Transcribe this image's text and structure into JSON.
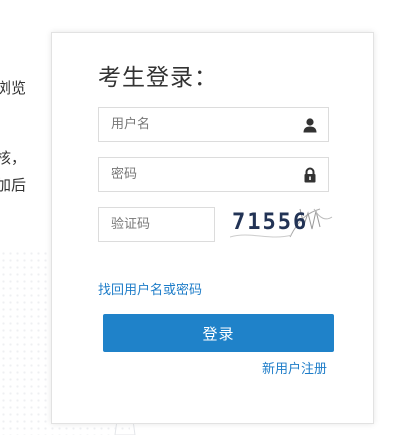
{
  "side_text": {
    "line1": "浏览",
    "line2": "核，",
    "line3": "加后"
  },
  "login": {
    "title": "考生登录：",
    "username": {
      "placeholder": "用户名",
      "value": "",
      "icon": "user-icon"
    },
    "password": {
      "placeholder": "密码",
      "value": "",
      "icon": "lock-icon"
    },
    "captcha": {
      "placeholder": "验证码",
      "value": "",
      "image_text": "71556"
    },
    "forgot_label": "找回用户名或密码",
    "submit_label": "登录",
    "register_label": "新用户注册"
  },
  "colors": {
    "accent": "#1f82c9",
    "link": "#1d7cc8",
    "border": "#dcdcdc",
    "title_text": "#333333"
  }
}
